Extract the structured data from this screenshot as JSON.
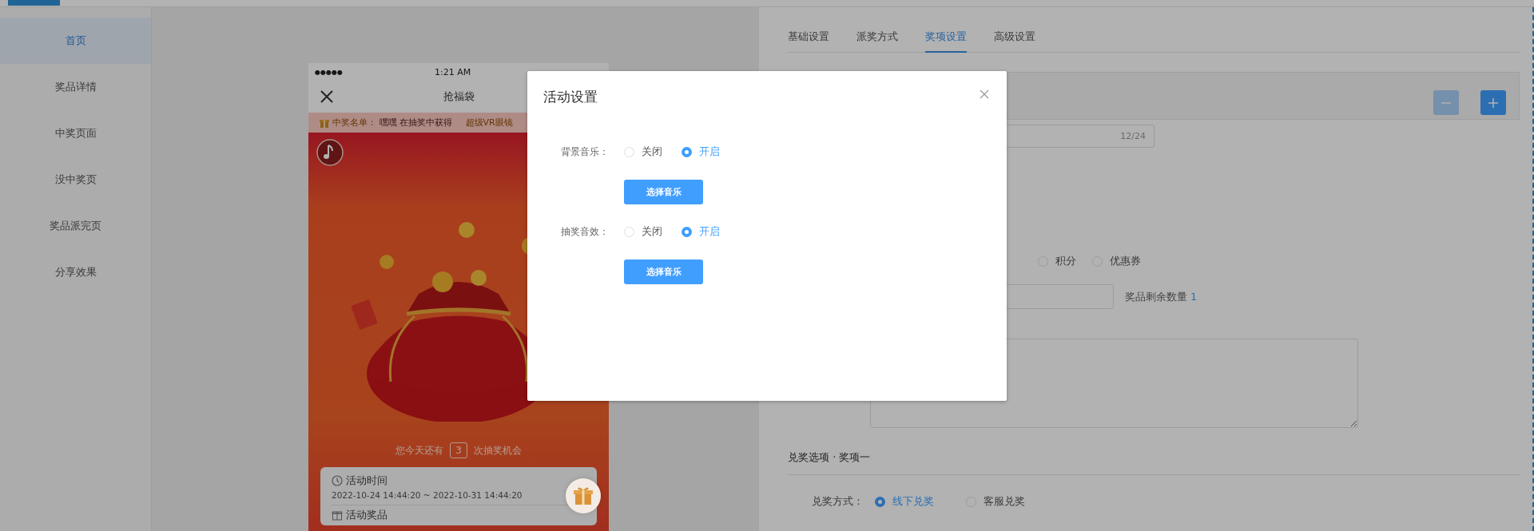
{
  "sidebar": {
    "items": [
      {
        "label": "首页",
        "selected": true
      },
      {
        "label": "奖品详情",
        "selected": false
      },
      {
        "label": "中奖页面",
        "selected": false
      },
      {
        "label": "没中奖页",
        "selected": false
      },
      {
        "label": "奖品派完页",
        "selected": false
      },
      {
        "label": "分享效果",
        "selected": false
      }
    ]
  },
  "phone": {
    "status": {
      "signal": "●●●●●",
      "time": "1:21 AM"
    },
    "nav": {
      "title": "抢福袋"
    },
    "marquee": {
      "label": "中奖名单：",
      "message": "嘿嘿 在抽奖中获得",
      "prize": "超级VR眼镜"
    },
    "chances": {
      "prefix": "您今天还有",
      "count": "3",
      "suffix": "次抽奖机会"
    },
    "info": [
      {
        "kind": "time",
        "title": "活动时间",
        "value": "2022-10-24 14:44:20 ~ 2022-10-31 14:44:20"
      },
      {
        "kind": "prize",
        "title": "活动奖品"
      }
    ]
  },
  "settings": {
    "tabs": [
      {
        "label": "基础设置",
        "selected": false
      },
      {
        "label": "派奖方式",
        "selected": false
      },
      {
        "label": "奖项设置",
        "selected": true
      },
      {
        "label": "高级设置",
        "selected": false
      }
    ],
    "counter": "12/24",
    "prize_types": [
      {
        "label": "积分",
        "selected": false
      },
      {
        "label": "优惠券",
        "selected": false
      }
    ],
    "remaining": {
      "label": "奖品剩余数量",
      "value": "1"
    },
    "section_title": "兑奖选项 · 奖项一",
    "redeem": {
      "label": "兑奖方式：",
      "options": [
        {
          "label": "线下兑奖",
          "selected": true
        },
        {
          "label": "客服兑奖",
          "selected": false
        }
      ]
    }
  },
  "modal": {
    "title": "活动设置",
    "rows": [
      {
        "label": "背景音乐：",
        "options": [
          {
            "label": "关闭",
            "selected": false
          },
          {
            "label": "开启",
            "selected": true
          }
        ],
        "button": "选择音乐"
      },
      {
        "label": "抽奖音效：",
        "options": [
          {
            "label": "关闭",
            "selected": false
          },
          {
            "label": "开启",
            "selected": true
          }
        ],
        "button": "选择音乐"
      }
    ]
  }
}
